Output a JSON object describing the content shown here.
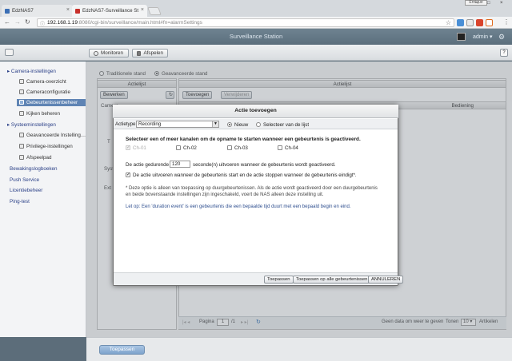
{
  "browser": {
    "tabs": [
      {
        "label": "EdzNAS7",
        "close": "×"
      },
      {
        "label": "EdzNAS7-Surveillance St",
        "close": "×"
      }
    ],
    "user_badge": "Enrique",
    "url_host": "192.168.1.19",
    "url_path": ":8080/cgi-bin/surveillance/main.html#fn=alarmSettings",
    "window_controls": [
      "–",
      "□",
      "×"
    ]
  },
  "app": {
    "title": "Surveillance Station",
    "user": "admin",
    "modes": [
      {
        "label": "Monitoren"
      },
      {
        "label": "Afspelen"
      }
    ],
    "help": "?"
  },
  "sidebar": {
    "sections": [
      {
        "label": "Camera-instellingen",
        "items": [
          "Camera-overzicht",
          "Cameraconfiguratie",
          "Gebeurtenissenbeheer",
          "Kijken beheren"
        ]
      },
      {
        "label": "Systeeminstellingen",
        "items": [
          "Geavanceerde Instelling…",
          "Privilege-instellingen",
          "Afspeelpad"
        ]
      }
    ],
    "links": [
      "Bewakingslogboeken",
      "Push Service",
      "Licentiebeheer",
      "Ping-test"
    ],
    "selected": "Gebeurtenissenbeheer"
  },
  "main": {
    "mode_options": [
      "Traditionele stand",
      "Geavanceerde stand"
    ],
    "selected_mode": "Geavanceerde stand",
    "left_header": "Actielijst",
    "left_button": "Bewerken",
    "right_header": "Actielijst",
    "right_buttons": [
      "Toevoegen",
      "Verwijderen"
    ],
    "condition_col": "Bediening",
    "partial_labels": [
      "Camera...",
      "T",
      "Syst",
      "Ext"
    ],
    "pager": {
      "page_label": "Pagina",
      "page": "1",
      "total": "/1",
      "status": "Geen data om weer te geven",
      "show_label": "Tonen",
      "per_page": "10",
      "items_label": "Artikelen"
    },
    "save_label": "Toepassen"
  },
  "dialog": {
    "title": "Actie toevoegen",
    "actiontype_label": "Actietype",
    "actiontype_value": "Recording",
    "source_options": [
      "Nieuw",
      "Selecteer van de lijst"
    ],
    "selected_source": "Nieuw",
    "heading": "Selecteer een of meer kanalen om de opname te starten wanneer een gebeurtenis is geactiveerd.",
    "channels": [
      {
        "label": "Ch-01",
        "checked": true,
        "disabled": true
      },
      {
        "label": "Ch-02",
        "checked": false,
        "disabled": false
      },
      {
        "label": "Ch-03",
        "checked": false,
        "disabled": false
      },
      {
        "label": "Ch-04",
        "checked": false,
        "disabled": false
      }
    ],
    "duration_prefix": "De actie gedurende",
    "duration_value": "120",
    "duration_suffix": "seconde(n) uitvoeren wanneer de gebeurtenis wordt geactiveerd.",
    "event_end_label": "De actie uitvoeren wanneer de gebeurtenis start en de actie stoppen wanneer de gebeurtenis eindigt*.",
    "event_end_checked": true,
    "note_line1": "* Deze optie is alleen van toepassing op duurgebeurtenissen. Als de actie wordt geactiveerd door een duurgebeurtenis",
    "note_line2": "en beide bovenstaande instellingen zijn ingeschakeld, voert de NAS alleen deze instelling uit.",
    "tip": "Let op: Een 'duration event' is een gebeurtenis die een bepaalde tijd duurt met een bepaald begin en eind.",
    "buttons": [
      "Toepassen",
      "Toepassen op alle gebeurtenissen",
      "ANNULEREN"
    ]
  }
}
